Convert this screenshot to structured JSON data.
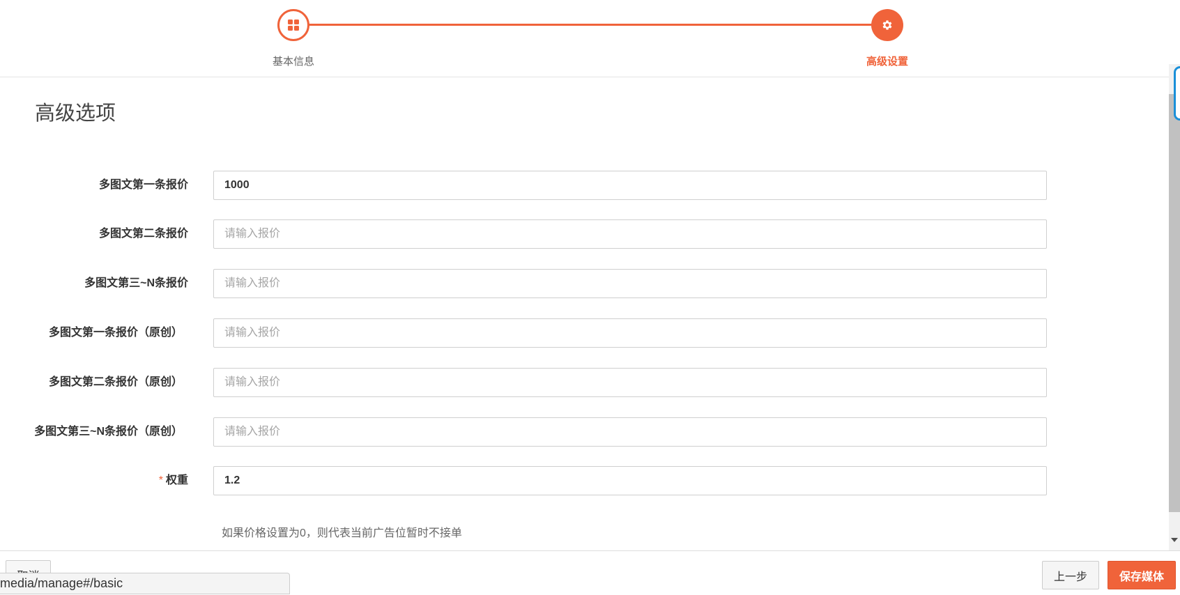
{
  "steps": [
    {
      "label": "基本信息",
      "icon": "grid-icon",
      "state": "completed"
    },
    {
      "label": "高级设置",
      "icon": "gear-icon",
      "state": "active"
    }
  ],
  "accent_color": "#f0633a",
  "section": {
    "title": "高级选项"
  },
  "fields": [
    {
      "label": "多图文第一条报价",
      "value": "1000",
      "placeholder": "请输入报价",
      "required": false
    },
    {
      "label": "多图文第二条报价",
      "value": "",
      "placeholder": "请输入报价",
      "required": false
    },
    {
      "label": "多图文第三~N条报价",
      "value": "",
      "placeholder": "请输入报价",
      "required": false
    },
    {
      "label": "多图文第一条报价（原创）",
      "value": "",
      "placeholder": "请输入报价",
      "required": false
    },
    {
      "label": "多图文第二条报价（原创）",
      "value": "",
      "placeholder": "请输入报价",
      "required": false
    },
    {
      "label": "多图文第三~N条报价（原创）",
      "value": "",
      "placeholder": "请输入报价",
      "required": false
    },
    {
      "label": "权重",
      "value": "1.2",
      "placeholder": "",
      "required": true,
      "required_mark": "*"
    }
  ],
  "hint": "如果价格设置为0，则代表当前广告位暂时不接单",
  "footer": {
    "cancel_label": "取消",
    "prev_label": "上一步",
    "save_label": "保存媒体"
  },
  "status_url": "media/manage#/basic"
}
